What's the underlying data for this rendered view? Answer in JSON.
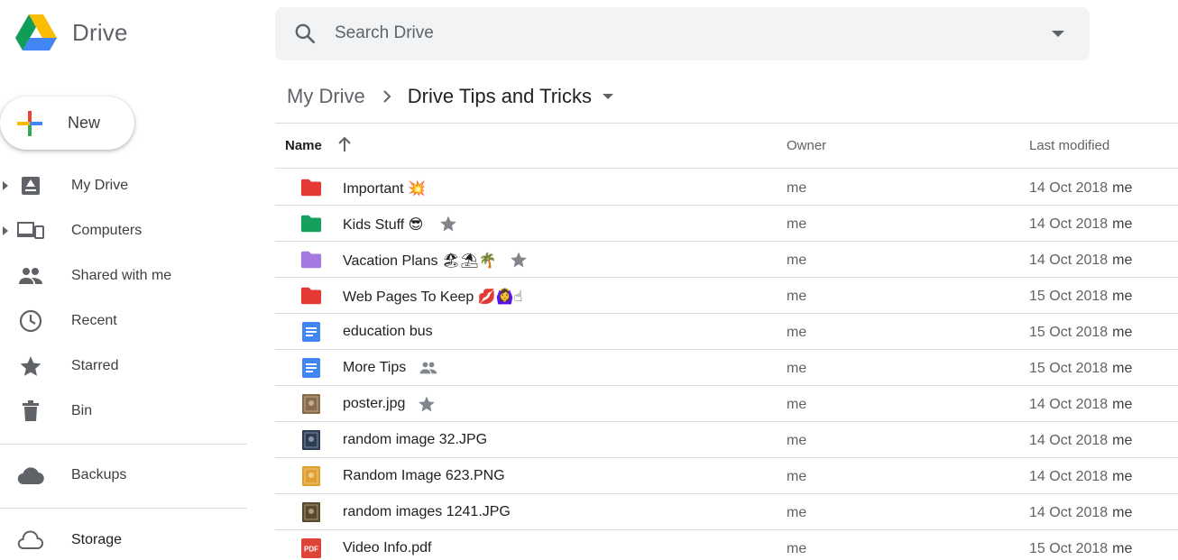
{
  "app": {
    "title": "Drive"
  },
  "search": {
    "placeholder": "Search Drive"
  },
  "new_button": {
    "label": "New"
  },
  "sidebar": {
    "items": [
      {
        "label": "My Drive",
        "icon": "my-drive-icon",
        "expandable": true
      },
      {
        "label": "Computers",
        "icon": "computers-icon",
        "expandable": true
      },
      {
        "label": "Shared with me",
        "icon": "shared-people-icon",
        "expandable": false
      },
      {
        "label": "Recent",
        "icon": "clock-icon",
        "expandable": false
      },
      {
        "label": "Starred",
        "icon": "star-icon",
        "expandable": false
      },
      {
        "label": "Bin",
        "icon": "bin-icon",
        "expandable": false
      }
    ],
    "backups": {
      "label": "Backups",
      "icon": "cloud-filled-icon"
    },
    "storage": {
      "label": "Storage",
      "icon": "cloud-outline-icon"
    }
  },
  "breadcrumb": {
    "root": "My Drive",
    "current": "Drive Tips and Tricks"
  },
  "table": {
    "columns": {
      "name": "Name",
      "owner": "Owner",
      "modified": "Last modified"
    },
    "rows": [
      {
        "name": "Important 💥",
        "type": "folder",
        "color": "#e53935",
        "starred": false,
        "shared": false,
        "owner": "me",
        "date": "14 Oct 2018",
        "by": "me"
      },
      {
        "name": "Kids Stuff 😎",
        "type": "folder",
        "color": "#16a05d",
        "starred": true,
        "shared": false,
        "owner": "me",
        "date": "14 Oct 2018",
        "by": "me"
      },
      {
        "name": "Vacation Plans 🏖⛱🌴",
        "type": "folder",
        "color": "#a479e2",
        "starred": true,
        "shared": false,
        "owner": "me",
        "date": "14 Oct 2018",
        "by": "me"
      },
      {
        "name": "Web Pages To Keep 💋🙆‍♀️☝",
        "type": "folder",
        "color": "#e53935",
        "starred": false,
        "shared": false,
        "owner": "me",
        "date": "15 Oct 2018",
        "by": "me"
      },
      {
        "name": "education bus",
        "type": "doc",
        "color": "#4285f4",
        "starred": false,
        "shared": false,
        "owner": "me",
        "date": "15 Oct 2018",
        "by": "me"
      },
      {
        "name": "More Tips",
        "type": "doc",
        "color": "#4285f4",
        "starred": false,
        "shared": true,
        "owner": "me",
        "date": "15 Oct 2018",
        "by": "me"
      },
      {
        "name": "poster.jpg",
        "type": "image",
        "color": "#8a6b4a",
        "starred": true,
        "shared": false,
        "owner": "me",
        "date": "14 Oct 2018",
        "by": "me"
      },
      {
        "name": "random image 32.JPG",
        "type": "image",
        "color": "#2c3e55",
        "starred": false,
        "shared": false,
        "owner": "me",
        "date": "14 Oct 2018",
        "by": "me"
      },
      {
        "name": "Random Image 623.PNG",
        "type": "image",
        "color": "#e0a030",
        "starred": false,
        "shared": false,
        "owner": "me",
        "date": "14 Oct 2018",
        "by": "me"
      },
      {
        "name": "random images 1241.JPG",
        "type": "image",
        "color": "#5b4a2a",
        "starred": false,
        "shared": false,
        "owner": "me",
        "date": "14 Oct 2018",
        "by": "me"
      },
      {
        "name": "Video Info.pdf",
        "type": "pdf",
        "color": "#db4437",
        "starred": false,
        "shared": false,
        "owner": "me",
        "date": "15 Oct 2018",
        "by": "me",
        "icon_text": "PDF"
      }
    ]
  },
  "colors": {
    "accent": "#4285f4",
    "text": "#202124",
    "muted": "#5f6368",
    "divider": "#dadce0"
  }
}
